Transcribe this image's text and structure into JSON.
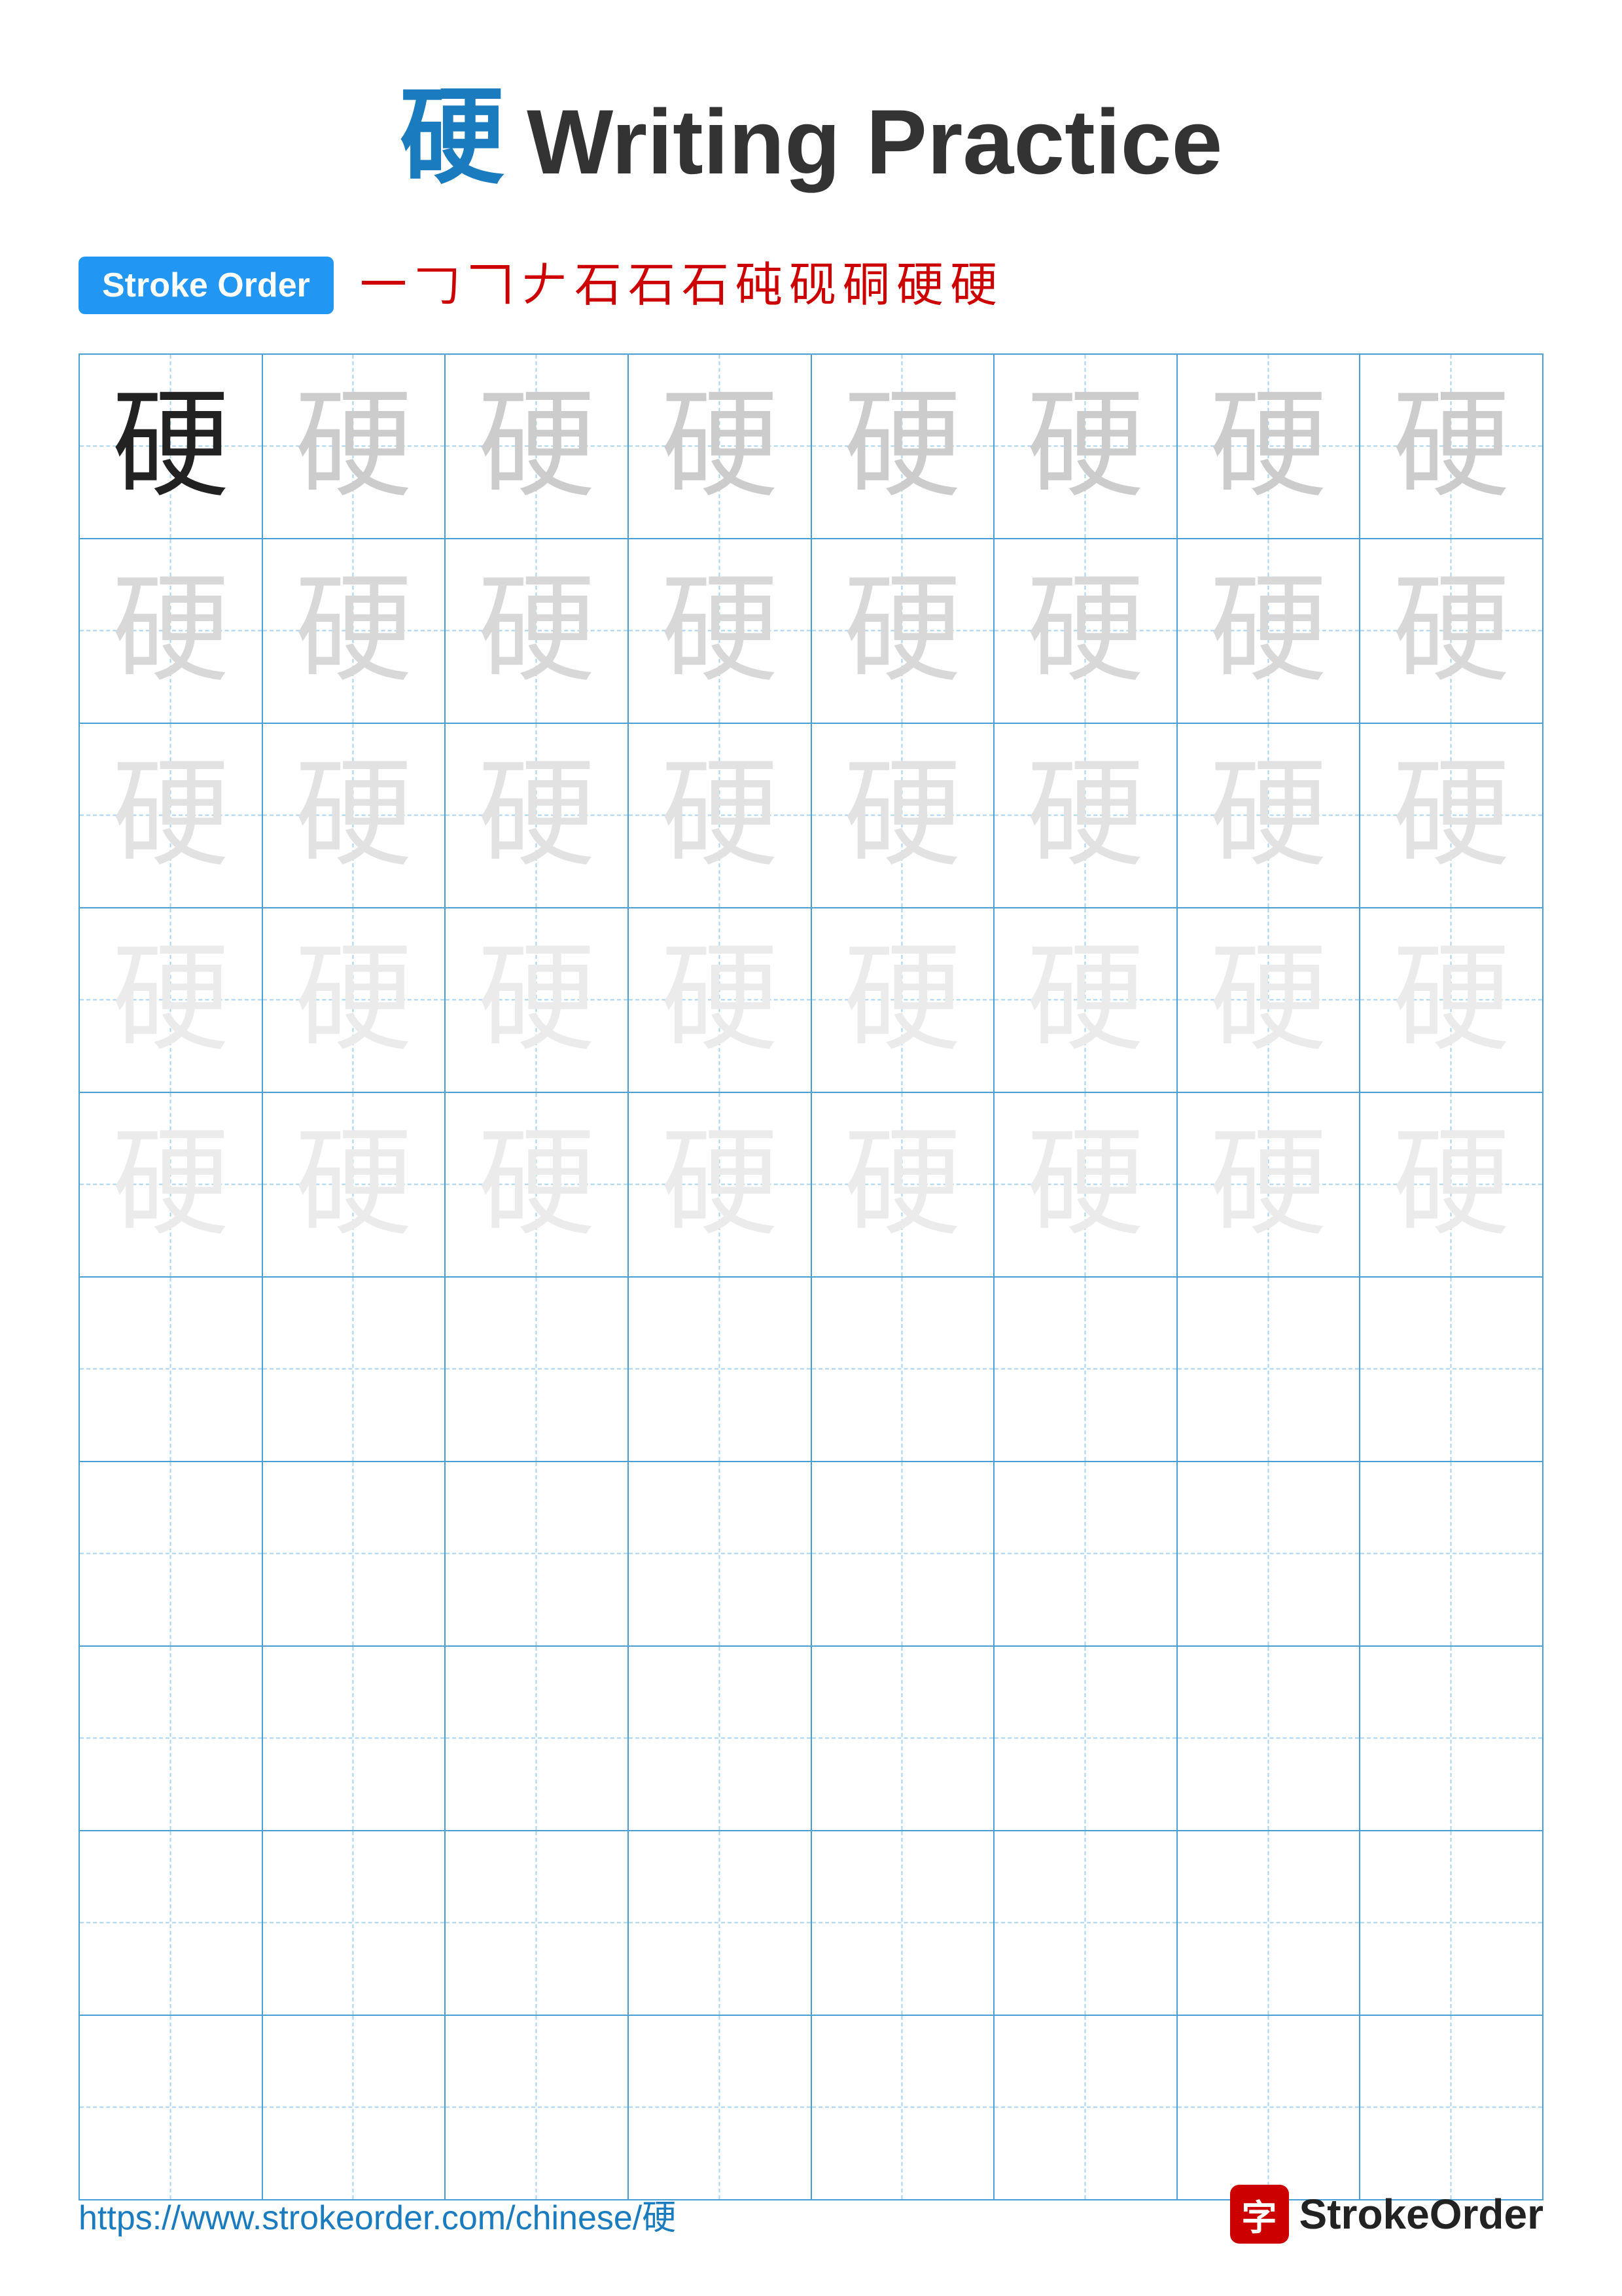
{
  "title": {
    "char": "硬",
    "text": "Writing Practice"
  },
  "stroke_order": {
    "badge_label": "Stroke Order",
    "strokes": [
      "一",
      "𠃌",
      "𠃍",
      "𠂇",
      "石",
      "石",
      "石",
      "砘",
      "砚",
      "硐",
      "硬",
      "硬"
    ]
  },
  "grid": {
    "rows": 10,
    "cols": 8,
    "char": "硬",
    "practice_char": "硬",
    "filled_rows": 5,
    "empty_rows": 5
  },
  "footer": {
    "url": "https://www.strokeorder.com/chinese/硬",
    "brand_char": "字",
    "brand_name": "StrokeOrder"
  }
}
